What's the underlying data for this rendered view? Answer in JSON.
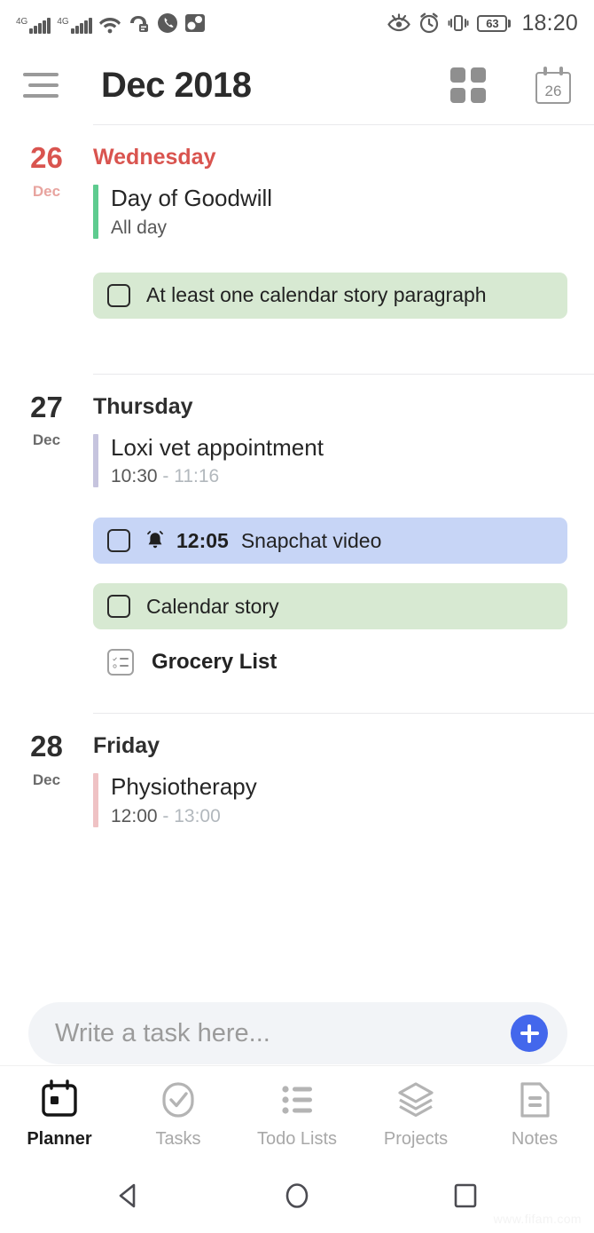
{
  "statusbar": {
    "network_label_1": "4G",
    "network_label_2": "4G",
    "battery_percent": "63",
    "time": "18:20",
    "icons": [
      "signal-4g-sim1-icon",
      "signal-4g-sim2-icon",
      "wifi-icon",
      "voicemail-icon",
      "missed-call-icon",
      "photo-icon",
      "eye-comfort-icon",
      "alarm-icon",
      "vibrate-icon",
      "battery-icon"
    ]
  },
  "header": {
    "title": "Dec 2018",
    "menu_icon": "hamburger-menu-icon",
    "grid_icon": "grid-view-icon",
    "calendar_icon_day": "26"
  },
  "days": [
    {
      "num": "26",
      "month": "Dec",
      "weekday": "Wednesday",
      "is_today": true,
      "events": [
        {
          "title": "Day of Goodwill",
          "time": "All day",
          "time_end": "",
          "bar_color": "#5ecb8f"
        }
      ],
      "tasks": [
        {
          "label": "At least one calendar story paragraph",
          "color": "green",
          "time": "",
          "has_alarm": false
        }
      ],
      "todo_lists": []
    },
    {
      "num": "27",
      "month": "Dec",
      "weekday": "Thursday",
      "is_today": false,
      "events": [
        {
          "title": "Loxi vet appointment",
          "time": "10:30",
          "time_end": "11:16",
          "bar_color": "#c6c4de"
        }
      ],
      "tasks": [
        {
          "label": "Snapchat video",
          "color": "blue",
          "time": "12:05",
          "has_alarm": true
        },
        {
          "label": "Calendar story",
          "color": "green",
          "time": "",
          "has_alarm": false
        }
      ],
      "todo_lists": [
        {
          "label": "Grocery List",
          "icon": "todo-list-icon"
        }
      ]
    },
    {
      "num": "28",
      "month": "Dec",
      "weekday": "Friday",
      "is_today": false,
      "events": [
        {
          "title": "Physiotherapy",
          "time": "12:00",
          "time_end": "13:00",
          "bar_color": "#efc2c4"
        }
      ],
      "tasks": [],
      "todo_lists": []
    }
  ],
  "composer": {
    "placeholder": "Write a task here...",
    "value": "",
    "add_button_icon": "plus-icon",
    "accent": "#4367ec"
  },
  "bottomnav": {
    "items": [
      {
        "label": "Planner",
        "icon": "planner-calendar-icon",
        "active": true
      },
      {
        "label": "Tasks",
        "icon": "check-circle-icon",
        "active": false
      },
      {
        "label": "Todo Lists",
        "icon": "bullet-list-icon",
        "active": false
      },
      {
        "label": "Projects",
        "icon": "layers-icon",
        "active": false
      },
      {
        "label": "Notes",
        "icon": "note-document-icon",
        "active": false
      }
    ]
  },
  "androidnav": {
    "back_icon": "back-triangle-icon",
    "home_icon": "home-circle-icon",
    "recents_icon": "recents-square-icon"
  },
  "watermark": "www.fifam.com",
  "colors": {
    "today_red": "#d9544f",
    "task_green": "#d7e9d2",
    "task_blue": "#c7d5f6",
    "accent_blue": "#4367ec"
  }
}
